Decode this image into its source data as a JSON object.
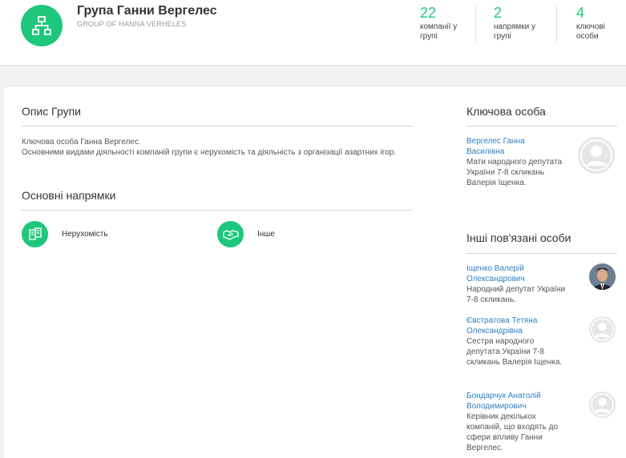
{
  "header": {
    "title": "Група Ганни Вергелес",
    "subtitle": "GROUP OF HANNA VERHELES",
    "stats": [
      {
        "value": "22",
        "label_line1": "компанії у",
        "label_line2": "групі"
      },
      {
        "value": "2",
        "label_line1": "напрямки у",
        "label_line2": "групі"
      },
      {
        "value": "4",
        "label_line1": "ключові",
        "label_line2": "особи"
      }
    ]
  },
  "description": {
    "title": "Опис Групи",
    "line1": "Ключова особа Ганна Вергелес.",
    "line2": "Основними видами діяльності компаній групи є нерухомість та діяльність з організації азартних ігор."
  },
  "directions": {
    "title": "Основні напрямки",
    "items": [
      {
        "label": "Нерухомість",
        "icon": "real-estate-icon"
      },
      {
        "label": "Інше",
        "icon": "handshake-icon"
      }
    ]
  },
  "key_person": {
    "title": "Ключова особа",
    "name": "Вергелес Ганна Василівна",
    "desc": "Мати народного депутата України 7-8 скликань Валерія Іщенка."
  },
  "related": {
    "title": "Інші пов'язані особи",
    "people": [
      {
        "name": "Іщенко Валерій Олександрович",
        "desc": "Народний депутат України 7-8 скликань."
      },
      {
        "name": "Євстратова Тетяна Олександрівна",
        "desc": "Сестра народного депутата України 7-8 скликань Валерія Іщенка."
      },
      {
        "name": "Бондарчук Анатолій Володимирович",
        "desc": "Керівник декількох компаній, що входять до сфери впливу Ганни Вергелес."
      }
    ]
  },
  "colors": {
    "accent": "#1ec77c",
    "link": "#2f7fbf"
  }
}
